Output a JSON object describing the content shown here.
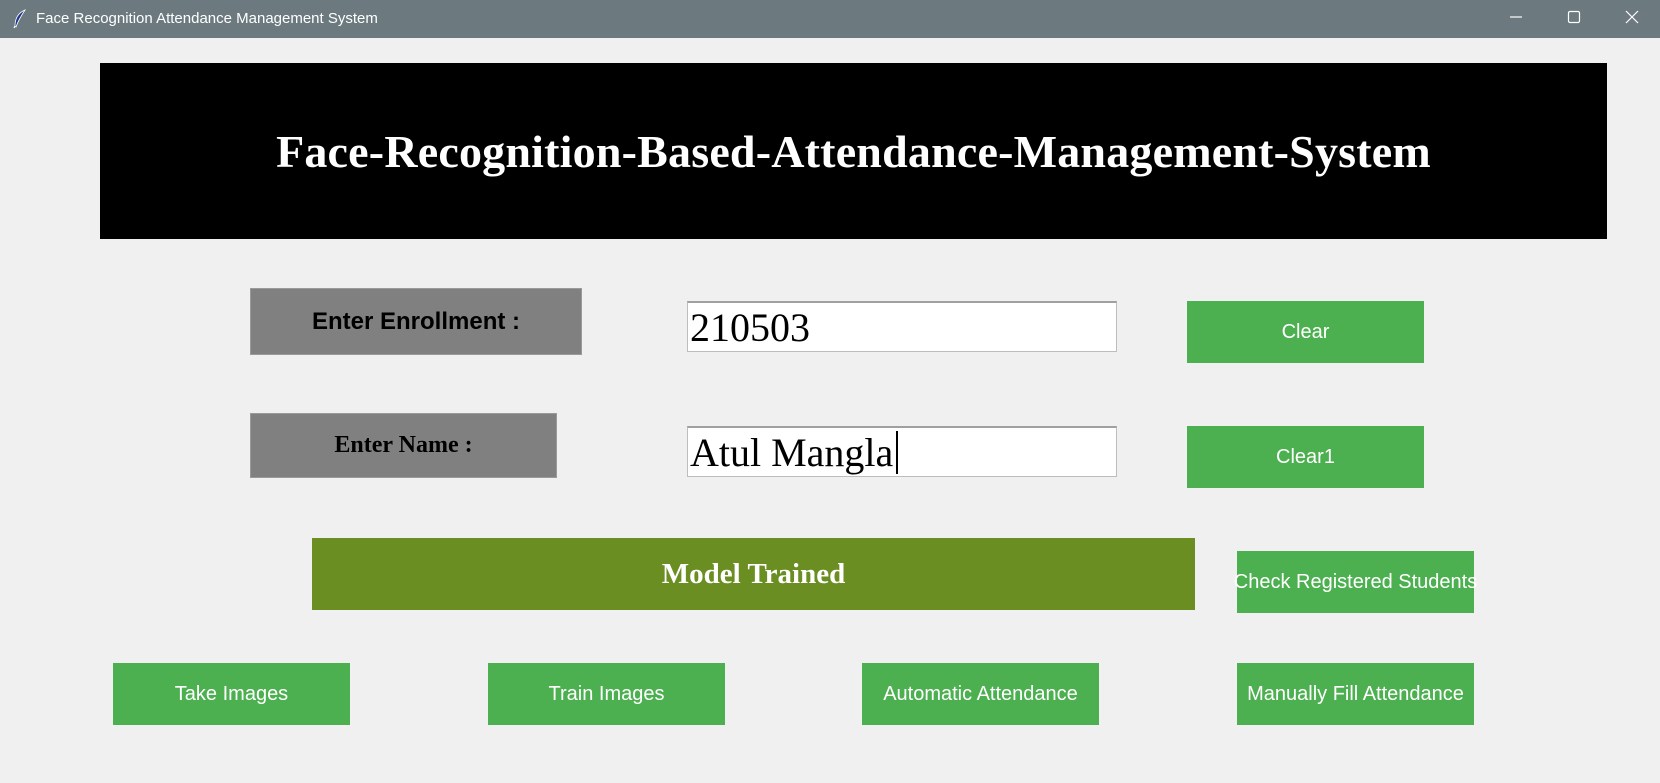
{
  "window": {
    "title": "Face Recognition Attendance Management System",
    "app_icon": "feather-icon",
    "controls": [
      "minimize-icon",
      "maximize-icon",
      "close-icon"
    ]
  },
  "banner": {
    "text": "Face-Recognition-Based-Attendance-Management-System"
  },
  "form": {
    "enrollment_label": "Enter Enrollment :",
    "enrollment_value": "210503",
    "name_label": "Enter Name :",
    "name_value": "Atul Mangla"
  },
  "buttons": {
    "clear": "Clear",
    "clear1": "Clear1",
    "check_registered": "Check Registered Students",
    "take_images": "Take Images",
    "train_images": "Train Images",
    "automatic_attendance": "Automatic Attendance",
    "manual_attendance": "Manually Fill Attendance"
  },
  "status": {
    "message": "Model Trained"
  },
  "colors": {
    "titlebar": "#6c7a80",
    "background": "#f0f0f0",
    "banner": "#000000",
    "button": "#4caf50",
    "status": "#6b8e23",
    "label": "#808080"
  }
}
